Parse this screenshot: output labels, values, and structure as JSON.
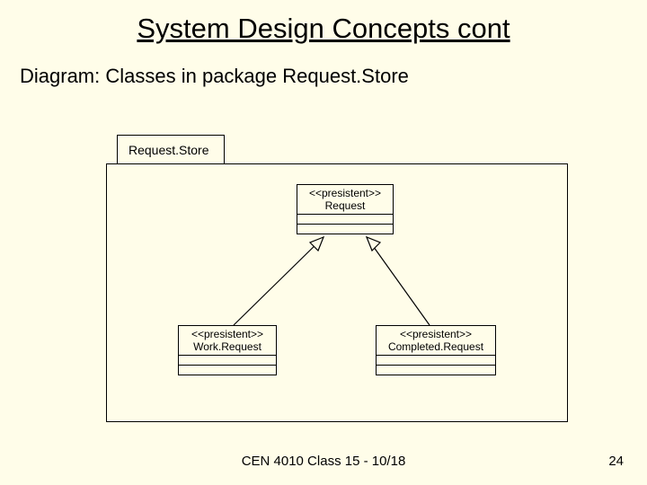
{
  "title": "System Design Concepts cont",
  "subtitle": "Diagram: Classes in package Request.Store",
  "package": {
    "name": "Request.Store"
  },
  "classes": {
    "request": {
      "stereotype": "<<presistent>>",
      "name": "Request"
    },
    "work": {
      "stereotype": "<<presistent>>",
      "name": "Work.Request"
    },
    "completed": {
      "stereotype": "<<presistent>>",
      "name": "Completed.Request"
    }
  },
  "footer": {
    "center": "CEN 4010 Class 15 - 10/18",
    "pageNumber": "24"
  },
  "chart_data": {
    "type": "table",
    "description": "UML package diagram",
    "package": "Request.Store",
    "nodes": [
      {
        "id": "Request",
        "stereotype": "presistent"
      },
      {
        "id": "Work.Request",
        "stereotype": "presistent"
      },
      {
        "id": "Completed.Request",
        "stereotype": "presistent"
      }
    ],
    "edges": [
      {
        "from": "Work.Request",
        "to": "Request",
        "type": "generalization"
      },
      {
        "from": "Completed.Request",
        "to": "Request",
        "type": "generalization"
      }
    ]
  }
}
